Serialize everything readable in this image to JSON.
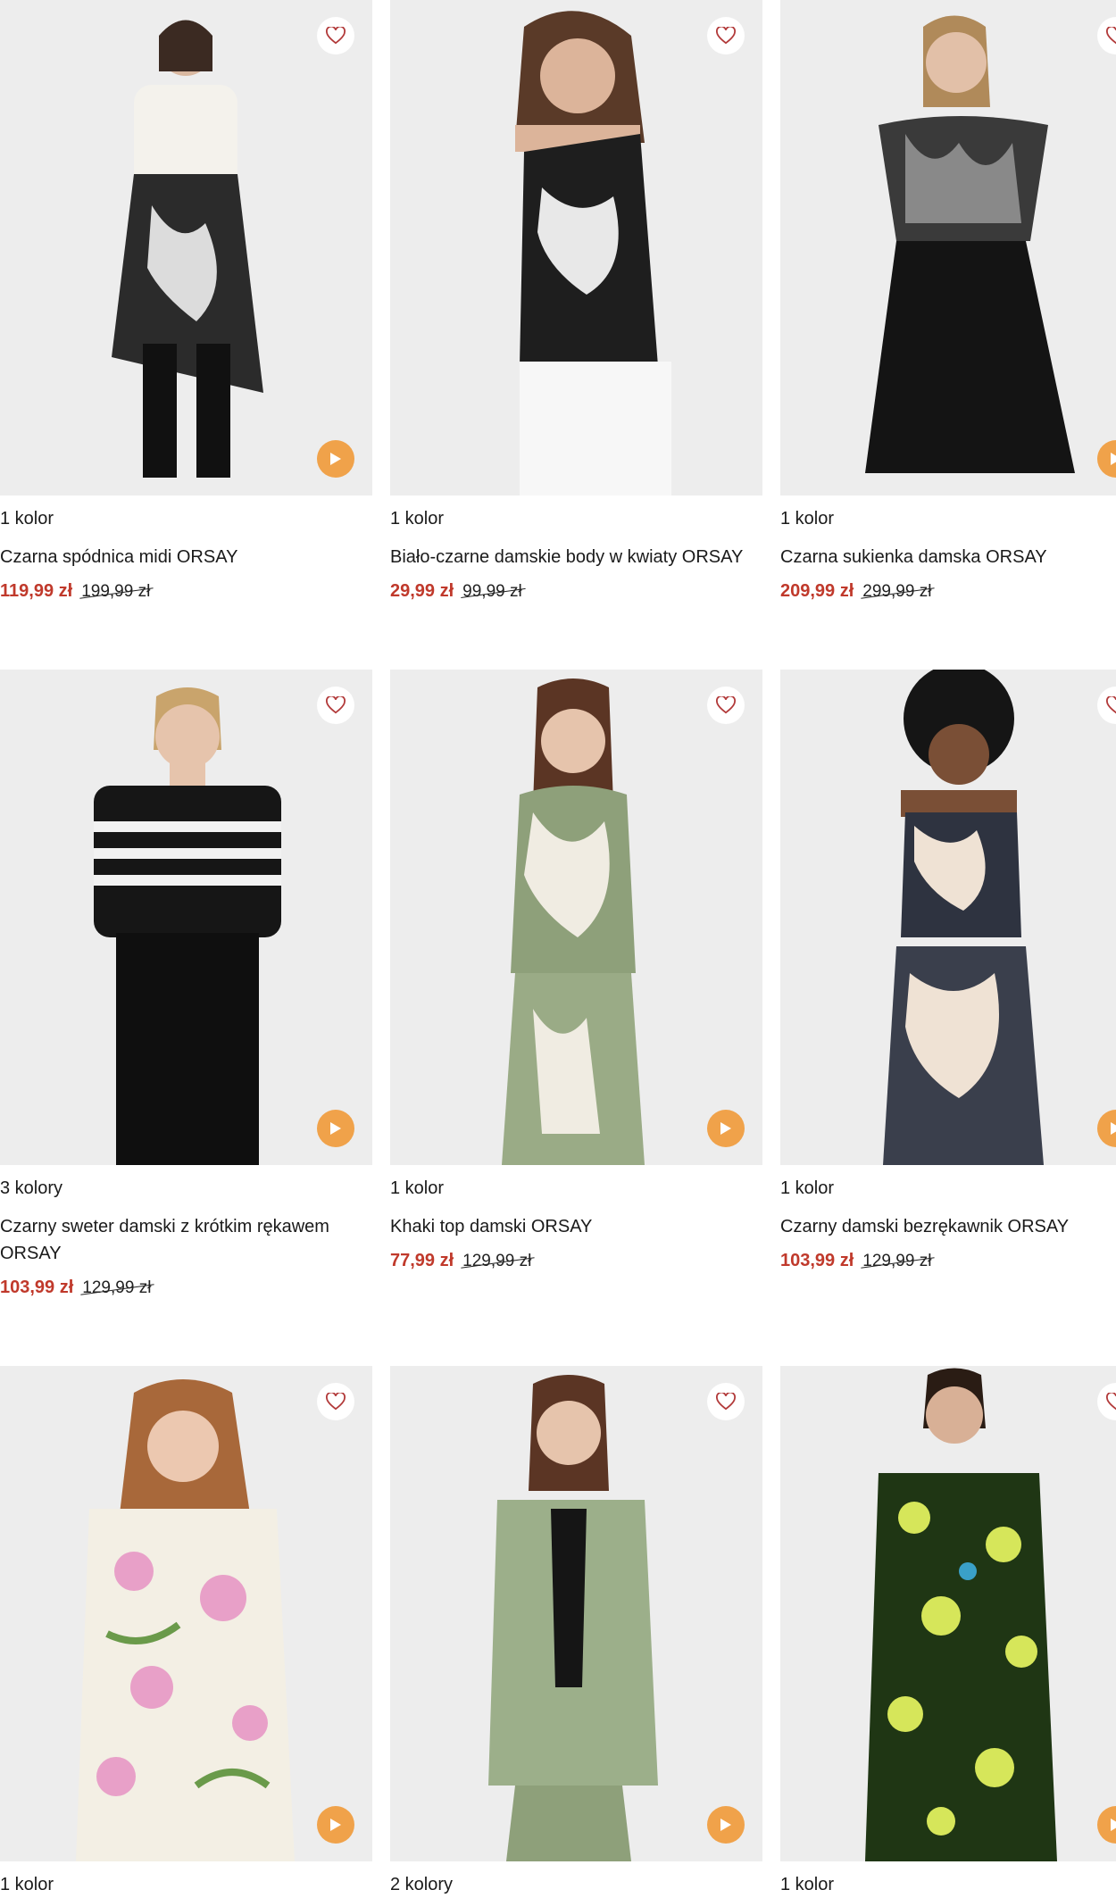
{
  "products": [
    {
      "colors": "1 kolor",
      "name": "Czarna spódnica midi ORSAY",
      "price": "119,99 zł",
      "old_price": "199,99 zł",
      "top": "#f4f2ec",
      "bottom": "#2b2b2b"
    },
    {
      "colors": "1 kolor",
      "name": "Biało-czarne damskie body w kwiaty ORSAY",
      "price": "29,99 zł",
      "old_price": "99,99 zł",
      "top": "#1e1e1e",
      "bottom": "#f7f7f7"
    },
    {
      "colors": "1 kolor",
      "name": "Czarna sukienka damska ORSAY",
      "price": "209,99 zł",
      "old_price": "299,99 zł",
      "top": "#3a3a3a",
      "bottom": "#141414"
    },
    {
      "colors": "3 kolory",
      "name": "Czarny sweter damski z krótkim rękawem ORSAY",
      "price": "103,99 zł",
      "old_price": "129,99 zł",
      "top": "#161616",
      "bottom": "#0f0f0f"
    },
    {
      "colors": "1 kolor",
      "name": "Khaki top damski ORSAY",
      "price": "77,99 zł",
      "old_price": "129,99 zł",
      "top": "#8ea07a",
      "bottom": "#9aab86"
    },
    {
      "colors": "1 kolor",
      "name": "Czarny damski bezrękawnik ORSAY",
      "price": "103,99 zł",
      "old_price": "129,99 zł",
      "top": "#2e3340",
      "bottom": "#3a3f4c"
    },
    {
      "colors": "1 kolor",
      "name": "",
      "price": "",
      "old_price": "",
      "top": "#e9d4da",
      "bottom": "#dcc6cc"
    },
    {
      "colors": "2 kolory",
      "name": "",
      "price": "",
      "old_price": "",
      "top": "#9caf8a",
      "bottom": "#8ea07a"
    },
    {
      "colors": "1 kolor",
      "name": "",
      "price": "",
      "old_price": "",
      "top": "#2f4a1e",
      "bottom": "#1f3614"
    }
  ],
  "accent": "#c0392b",
  "play_color": "#f0a24a",
  "icons": {
    "favorite": "heart-icon",
    "video": "play-icon"
  }
}
